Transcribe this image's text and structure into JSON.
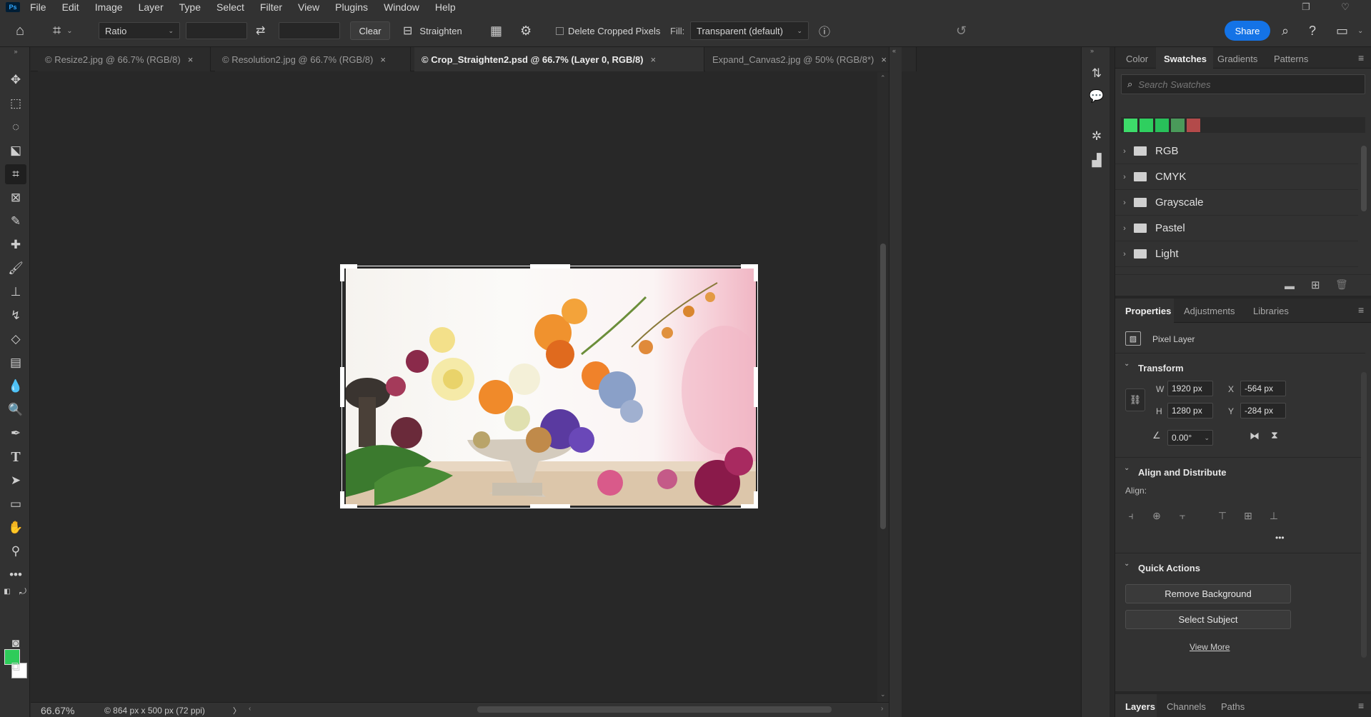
{
  "app": {
    "logo": "Ps"
  },
  "menu": [
    "File",
    "Edit",
    "Image",
    "Layer",
    "Type",
    "Select",
    "Filter",
    "View",
    "Plugins",
    "Window",
    "Help"
  ],
  "options": {
    "ratio": "Ratio",
    "clear": "Clear",
    "straighten": "Straighten",
    "delete_cropped": "Delete Cropped Pixels",
    "fill_label": "Fill:",
    "fill_value": "Transparent (default)",
    "share": "Share"
  },
  "tabs": [
    {
      "label": "© Resize2.jpg @ 66.7% (RGB/8)"
    },
    {
      "label": "© Resolution2.jpg @ 66.7% (RGB/8)"
    },
    {
      "label": "© Crop_Straighten2.psd @ 66.7% (Layer 0, RGB/8)"
    },
    {
      "label": "Expand_Canvas2.jpg @ 50% (RGB/8*)"
    }
  ],
  "status": {
    "zoom": "66.67%",
    "info": "© 864 px x 500 px (72 ppi)",
    "arrow": "〉"
  },
  "panels": {
    "top_tabs": [
      "Color",
      "Swatches",
      "Gradients",
      "Patterns"
    ],
    "search_placeholder": "Search Swatches",
    "recent_swatches": [
      "#3ddc6a",
      "#2fcf5f",
      "#28c05a",
      "#4a9a5a",
      "#b34a4a"
    ],
    "swatch_groups": [
      "RGB",
      "CMYK",
      "Grayscale",
      "Pastel",
      "Light"
    ],
    "prop_tabs": [
      "Properties",
      "Adjustments",
      "Libraries"
    ],
    "layer_kind": "Pixel Layer",
    "transform": {
      "title": "Transform",
      "w_label": "W",
      "w": "1920 px",
      "h_label": "H",
      "h": "1280 px",
      "x_label": "X",
      "x": "-564 px",
      "y_label": "Y",
      "y": "-284 px",
      "angle": "0.00°"
    },
    "align": {
      "title": "Align and Distribute",
      "label": "Align:",
      "more": "•••"
    },
    "quick": {
      "title": "Quick Actions",
      "remove_bg": "Remove Background",
      "select_subject": "Select Subject",
      "view_more": "View More"
    },
    "bottom_tabs": [
      "Layers",
      "Channels",
      "Paths"
    ]
  },
  "colors": {
    "foreground": "#2ecc5a",
    "background": "#ffffff",
    "accent": "#1473e6"
  }
}
